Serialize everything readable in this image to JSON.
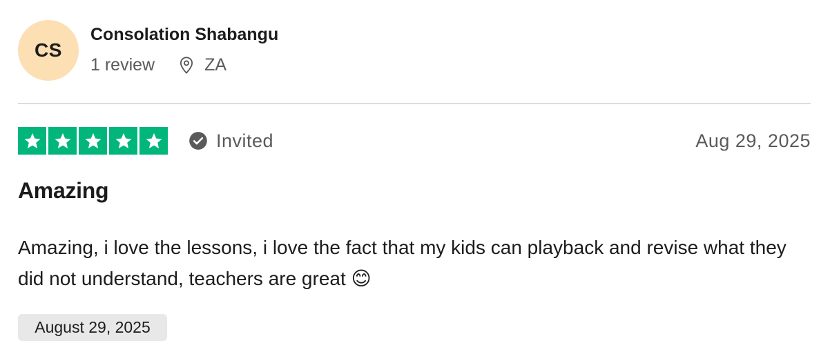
{
  "reviewer": {
    "initials": "CS",
    "name": "Consolation Shabangu",
    "review_count": "1 review",
    "country": "ZA",
    "avatar_color": "#fddfb4"
  },
  "review": {
    "rating": 5,
    "rating_max": 5,
    "star_color": "#00b67a",
    "verification_label": "Invited",
    "date": "Aug 29, 2025",
    "title": "Amazing",
    "body": "Amazing, i love the lessons, i love the fact that my kids can playback and revise what they did not understand, teachers are great 😊",
    "experience_date": "August 29, 2025"
  },
  "icons": {
    "location": "location-pin-icon",
    "verified": "check-circle-icon",
    "star": "star-icon"
  }
}
